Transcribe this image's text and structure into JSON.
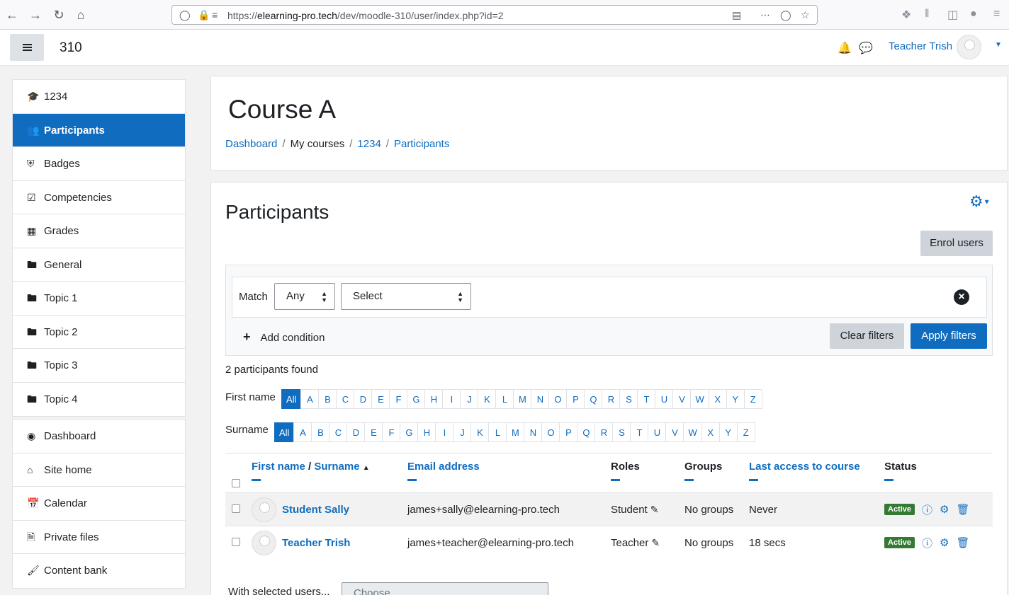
{
  "browser": {
    "url_prefix": "https://",
    "url_host": "elearning-pro.tech",
    "url_path": "/dev/moodle-310/user/index.php?id=2"
  },
  "navbar": {
    "site_name": "310",
    "user_name": "Teacher Trish"
  },
  "drawer": {
    "course_items": [
      {
        "label": "1234",
        "icon": "graduation-cap-icon"
      },
      {
        "label": "Participants",
        "icon": "users-icon"
      },
      {
        "label": "Badges",
        "icon": "shield-icon"
      },
      {
        "label": "Competencies",
        "icon": "check-square-icon"
      },
      {
        "label": "Grades",
        "icon": "table-icon"
      },
      {
        "label": "General",
        "icon": "folder-icon"
      },
      {
        "label": "Topic 1",
        "icon": "folder-icon"
      },
      {
        "label": "Topic 2",
        "icon": "folder-icon"
      },
      {
        "label": "Topic 3",
        "icon": "folder-icon"
      },
      {
        "label": "Topic 4",
        "icon": "folder-icon"
      }
    ],
    "site_items": [
      {
        "label": "Dashboard",
        "icon": "tachometer-icon"
      },
      {
        "label": "Site home",
        "icon": "home-icon"
      },
      {
        "label": "Calendar",
        "icon": "calendar-icon"
      },
      {
        "label": "Private files",
        "icon": "file-icon"
      },
      {
        "label": "Content bank",
        "icon": "paint-brush-icon"
      }
    ]
  },
  "header": {
    "course_title": "Course A",
    "breadcrumb": [
      "Dashboard",
      "My courses",
      "1234",
      "Participants"
    ]
  },
  "participants": {
    "title": "Participants",
    "enrol_label": "Enrol users",
    "filter": {
      "match_label": "Match",
      "match_value": "Any",
      "select_value": "Select",
      "add_condition": "Add condition",
      "clear_label": "Clear filters",
      "apply_label": "Apply filters"
    },
    "found_text": "2 participants found",
    "first_name_label": "First name",
    "surname_label": "Surname",
    "letters": [
      "All",
      "A",
      "B",
      "C",
      "D",
      "E",
      "F",
      "G",
      "H",
      "I",
      "J",
      "K",
      "L",
      "M",
      "N",
      "O",
      "P",
      "Q",
      "R",
      "S",
      "T",
      "U",
      "V",
      "W",
      "X",
      "Y",
      "Z"
    ],
    "columns": {
      "first_name": "First name",
      "slash": "/",
      "surname": "Surname",
      "email": "Email address",
      "roles": "Roles",
      "groups": "Groups",
      "last_access": "Last access to course",
      "status": "Status"
    },
    "rows": [
      {
        "name": "Student Sally",
        "email": "james+sally@elearning-pro.tech",
        "role": "Student",
        "groups": "No groups",
        "last_access": "Never",
        "status": "Active"
      },
      {
        "name": "Teacher Trish",
        "email": "james+teacher@elearning-pro.tech",
        "role": "Teacher",
        "groups": "No groups",
        "last_access": "18 secs",
        "status": "Active"
      }
    ],
    "with_selected": "With selected users...",
    "choose": "Choose..."
  },
  "colors": {
    "brand": "#0f6cbf",
    "active_badge": "#357a32"
  }
}
